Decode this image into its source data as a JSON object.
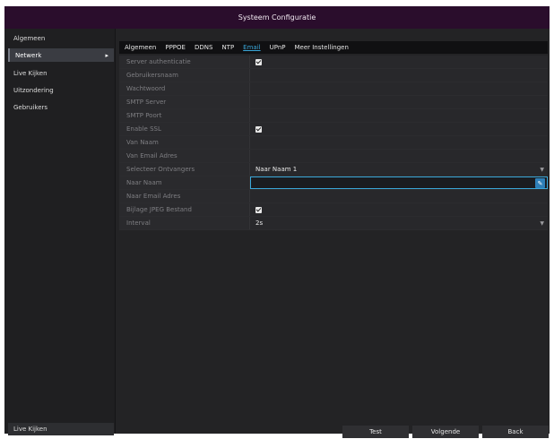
{
  "window": {
    "title": "Systeem Configuratie"
  },
  "sidebar": {
    "items": [
      {
        "label": "Algemeen",
        "active": false
      },
      {
        "label": "Netwerk",
        "active": true
      },
      {
        "label": "Live Kijken",
        "active": false
      },
      {
        "label": "Uitzondering",
        "active": false
      },
      {
        "label": "Gebruikers",
        "active": false
      }
    ],
    "bottom_label": "Live Kijken"
  },
  "tabs": [
    {
      "label": "Algemeen",
      "active": false
    },
    {
      "label": "PPPOE",
      "active": false
    },
    {
      "label": "DDNS",
      "active": false
    },
    {
      "label": "NTP",
      "active": false
    },
    {
      "label": "Email",
      "active": true
    },
    {
      "label": "UPnP",
      "active": false
    },
    {
      "label": "Meer Instellingen",
      "active": false
    }
  ],
  "form": {
    "server_auth": {
      "label": "Server authenticatie",
      "checked": true
    },
    "gebruikersnaam": {
      "label": "Gebruikersnaam",
      "value": ""
    },
    "wachtwoord": {
      "label": "Wachtwoord",
      "value": ""
    },
    "smtp_server": {
      "label": "SMTP Server",
      "value": ""
    },
    "smtp_poort": {
      "label": "SMTP Poort",
      "value": ""
    },
    "enable_ssl": {
      "label": "Enable SSL",
      "checked": true
    },
    "van_naam": {
      "label": "Van Naam",
      "value": ""
    },
    "van_email": {
      "label": "Van Email Adres",
      "value": ""
    },
    "selecteer_ontvangers": {
      "label": "Selecteer Ontvangers",
      "value": "Naar Naam 1"
    },
    "naar_naam": {
      "label": "Naar Naam",
      "value": ""
    },
    "naar_email": {
      "label": "Naar Email Adres",
      "value": ""
    },
    "bijlage_jpeg": {
      "label": "Bijlage JPEG Bestand",
      "checked": true
    },
    "interval": {
      "label": "Interval",
      "value": "2s"
    }
  },
  "buttons": {
    "test": "Test",
    "volgende": "Volgende",
    "back": "Back"
  },
  "colors": {
    "titlebar": "#2a0d2c",
    "accent": "#3aa7d9",
    "background": "#151517"
  }
}
